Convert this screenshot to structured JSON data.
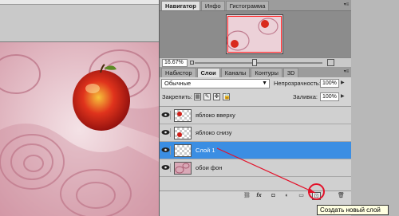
{
  "navigator": {
    "tabs": [
      {
        "label": "Навигатор",
        "active": true
      },
      {
        "label": "Инфо",
        "active": false
      },
      {
        "label": "Гистограмма",
        "active": false
      }
    ],
    "zoom": "16.67%"
  },
  "layers_panel": {
    "tabs": [
      {
        "label": "Набистор",
        "active": false
      },
      {
        "label": "Слои",
        "active": true
      },
      {
        "label": "Каналы",
        "active": false
      },
      {
        "label": "Контуры",
        "active": false
      },
      {
        "label": "3D",
        "active": false
      }
    ],
    "blend_mode": "Обычные",
    "opacity_label": "Непрозрачность:",
    "opacity_value": "100%",
    "lock_label": "Закрепить:",
    "fill_label": "Заливка:",
    "fill_value": "100%",
    "layers": [
      {
        "name": "яблоко вверху",
        "thumb": "apple",
        "selected": false
      },
      {
        "name": "яблоко снизу",
        "thumb": "apple",
        "selected": false
      },
      {
        "name": "Слой 1",
        "thumb": "empty",
        "selected": true
      },
      {
        "name": "обои фон",
        "thumb": "wallpaper",
        "selected": false
      }
    ],
    "footer_icons": [
      "link-icon",
      "fx-icon",
      "mask-icon",
      "adjustment-icon",
      "group-folder-icon",
      "new-layer-icon",
      "trash-icon"
    ],
    "footer_glyphs": {
      "link": "⛓",
      "fx": "fx",
      "mask": "◘",
      "adjustment": "◐",
      "group": "▭",
      "new": "⊡",
      "trash": "🗑"
    },
    "tooltip": "Создать новый слой"
  },
  "colors": {
    "selected_layer": "#3b8ee3",
    "annotation": "#e3122a",
    "canvas_pink": "#e8c7cf"
  }
}
